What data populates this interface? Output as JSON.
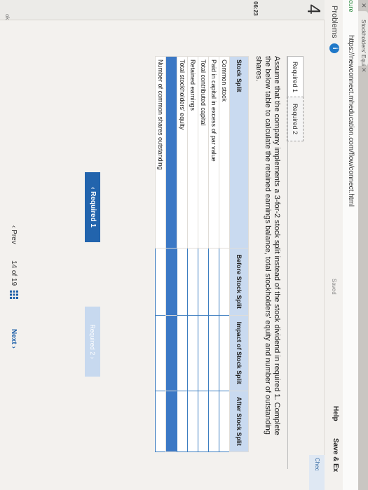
{
  "browser": {
    "tab_title": "Stockholders' Equity Ch",
    "secure_label": "cure",
    "url": "https://newconnect.mheducation.com/flow/connect.html"
  },
  "header": {
    "problems_label": "Problems",
    "info_icon": "i",
    "saved_label": "Saved",
    "help_label": "Help",
    "save_exit_label": "Save & Ex"
  },
  "side": {
    "question_number": "4",
    "timer": "06:23",
    "check_label": "Chec",
    "ok_label": "ok"
  },
  "tabs": {
    "req1": "Required 1",
    "req2": "Required 2"
  },
  "instruction": "Assume that the company implements a 3-for-2 stock split instead of the stock dividend in required 1. Complete the below table to calculate the retained earnings balance, total stockholders' equity and number of outstanding shares.",
  "table": {
    "header_label": "Stock Split",
    "col1": "Before Stock Split",
    "col2": "Impact of Stock Split",
    "col3": "After Stock Split",
    "rows": [
      "Common stock",
      "Paid in capital in excess of par value",
      "Total contributed capital",
      "Retained earnings",
      "Total stockholders' equity",
      "",
      "Number of common shares outstanding"
    ]
  },
  "nav": {
    "req1_label": "Required 1",
    "req2_label": "Required 2",
    "prev_label": "Prev",
    "page_current": "14",
    "page_of": "of",
    "page_total": "19",
    "next_label": "Next"
  }
}
